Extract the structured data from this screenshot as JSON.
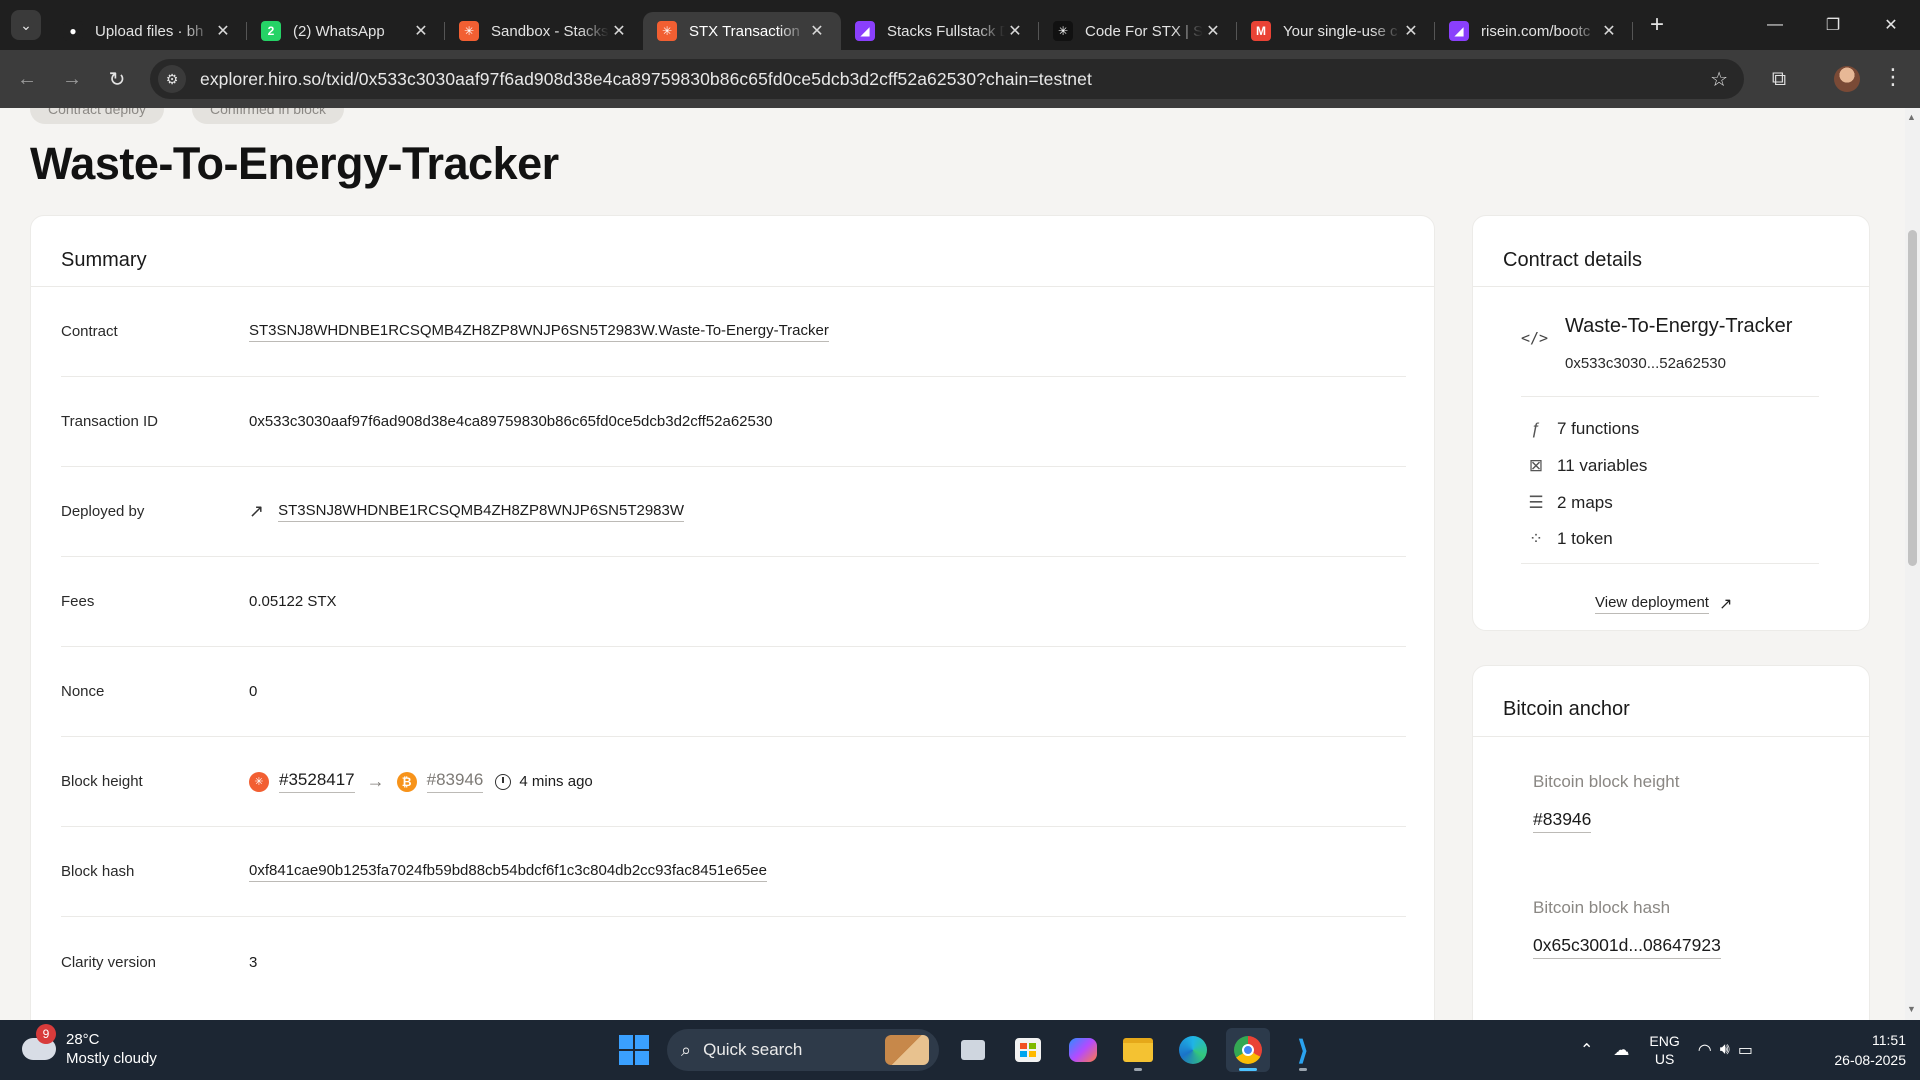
{
  "browser": {
    "tabs": [
      {
        "title": "Upload files · bh",
        "favicon": "github-icon",
        "fav_color": "#1f1f1f",
        "fav_glyph": "●"
      },
      {
        "title": "(2) WhatsApp",
        "favicon": "whatsapp-icon",
        "fav_color": "#25d366",
        "fav_glyph": "2"
      },
      {
        "title": "Sandbox - Stacks",
        "favicon": "stacks-icon",
        "fav_color": "#f25f32",
        "fav_glyph": "✳"
      },
      {
        "title": "STX Transaction",
        "favicon": "stacks-icon",
        "fav_color": "#f25f32",
        "fav_glyph": "✳"
      },
      {
        "title": "Stacks Fullstack D",
        "favicon": "risein-icon",
        "fav_color": "#8a3ffc",
        "fav_glyph": "◢"
      },
      {
        "title": "Code For STX | S",
        "favicon": "stacks-icon",
        "fav_color": "#111111",
        "fav_glyph": "✳"
      },
      {
        "title": "Your single-use c",
        "favicon": "gmail-icon",
        "fav_color": "#ea4335",
        "fav_glyph": "M"
      },
      {
        "title": "risein.com/bootc",
        "favicon": "risein-icon",
        "fav_color": "#8a3ffc",
        "fav_glyph": "◢"
      }
    ],
    "active_tab_index": 3,
    "url": "explorer.hiro.so/txid/0x533c3030aaf97f6ad908d38e4ca89759830b86c65fd0ce5dcb3d2cff52a62530?chain=testnet"
  },
  "page": {
    "pills": [
      "Contract deploy",
      "Confirmed in block"
    ],
    "title": "Waste-To-Energy-Tracker"
  },
  "summary": {
    "heading": "Summary",
    "contract_label": "Contract",
    "contract_value": "ST3SNJ8WHDNBE1RCSQMB4ZH8ZP8WNJP6SN5T2983W.Waste-To-Energy-Tracker",
    "txid_label": "Transaction ID",
    "txid_value": "0x533c3030aaf97f6ad908d38e4ca89759830b86c65fd0ce5dcb3d2cff52a62530",
    "deployer_label": "Deployed by",
    "deployer_value": "ST3SNJ8WHDNBE1RCSQMB4ZH8ZP8WNJP6SN5T2983W",
    "fees_label": "Fees",
    "fees_value": "0.05122 STX",
    "nonce_label": "Nonce",
    "nonce_value": "0",
    "block_height_label": "Block height",
    "stx_block": "#3528417",
    "btc_block": "#83946",
    "time_ago": "4 mins ago",
    "block_hash_label": "Block hash",
    "block_hash_value": "0xf841cae90b1253fa7024fb59bd88cb54bdcf6f1c3c804db2cc93fac8451e65ee",
    "clarity_label": "Clarity version",
    "clarity_value": "3"
  },
  "contract_details": {
    "heading": "Contract details",
    "name": "Waste-To-Energy-Tracker",
    "short_id": "0x533c3030...52a62530",
    "functions": "7 functions",
    "variables": "11 variables",
    "maps": "2 maps",
    "tokens": "1 token",
    "view_deployment": "View deployment"
  },
  "bitcoin_anchor": {
    "heading": "Bitcoin anchor",
    "height_label": "Bitcoin block height",
    "height_value": "#83946",
    "hash_label": "Bitcoin block hash",
    "hash_value": "0x65c3001d...08647923"
  },
  "taskbar": {
    "weather_badge": "9",
    "temperature": "28°C",
    "condition": "Mostly cloudy",
    "search_placeholder": "Quick search",
    "lang_top": "ENG",
    "lang_bottom": "US",
    "time": "11:51",
    "date": "26-08-2025"
  }
}
